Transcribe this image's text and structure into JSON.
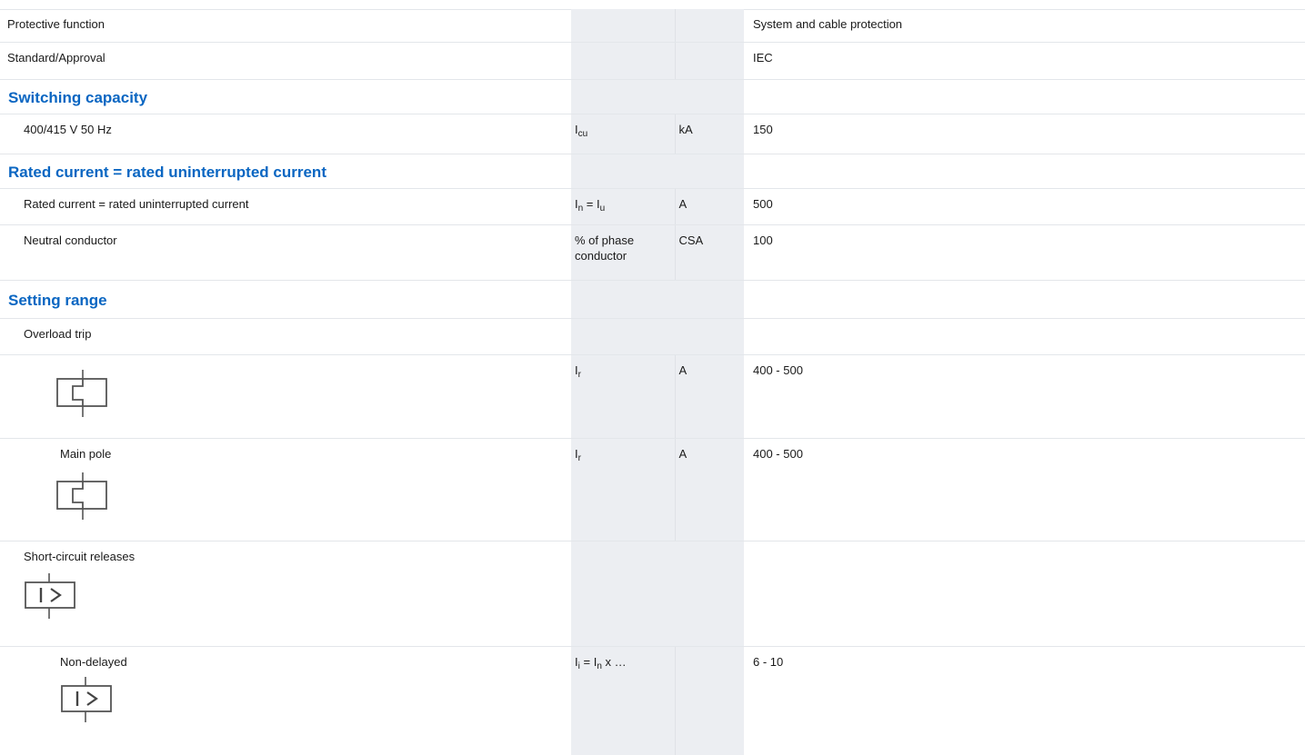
{
  "rows": {
    "protective_function": {
      "label": "Protective function",
      "value": "System and cable protection"
    },
    "standard_approval": {
      "label": "Standard/Approval",
      "value": "IEC"
    },
    "switching_capacity_heading": "Switching capacity",
    "voltage_400": {
      "label": "400/415 V 50 Hz",
      "symbol_main": "I",
      "symbol_sub": "cu",
      "unit": "kA",
      "value": "150"
    },
    "rated_current_heading": "Rated current = rated uninterrupted current",
    "rated_current": {
      "label": "Rated current = rated uninterrupted current",
      "symbol_a": "I",
      "symbol_a_sub": "n",
      "symbol_eq": " = ",
      "symbol_b": "I",
      "symbol_b_sub": "u",
      "unit": "A",
      "value": "500"
    },
    "neutral_conductor": {
      "label": "Neutral conductor",
      "symbol": "% of phase conductor",
      "unit": "CSA",
      "value": "100"
    },
    "setting_range_heading": "Setting range",
    "overload_trip": {
      "label": "Overload trip"
    },
    "overload_symbol_row": {
      "symbol_main": "I",
      "symbol_sub": "r",
      "unit": "A",
      "value": "400 - 500",
      "icon": "thermal-release-icon"
    },
    "main_pole": {
      "label": "Main pole",
      "symbol_main": "I",
      "symbol_sub": "r",
      "unit": "A",
      "value": "400 - 500",
      "icon": "thermal-release-icon"
    },
    "short_circuit": {
      "label": "Short-circuit releases",
      "icon": "short-circuit-release-icon"
    },
    "non_delayed": {
      "label": "Non-delayed",
      "symbol_a": "I",
      "symbol_a_sub": "i",
      "symbol_eq": " = ",
      "symbol_b": "I",
      "symbol_b_sub": "n",
      "symbol_tail": " x …",
      "value": "6 - 10",
      "icon": "short-circuit-release-icon"
    }
  }
}
